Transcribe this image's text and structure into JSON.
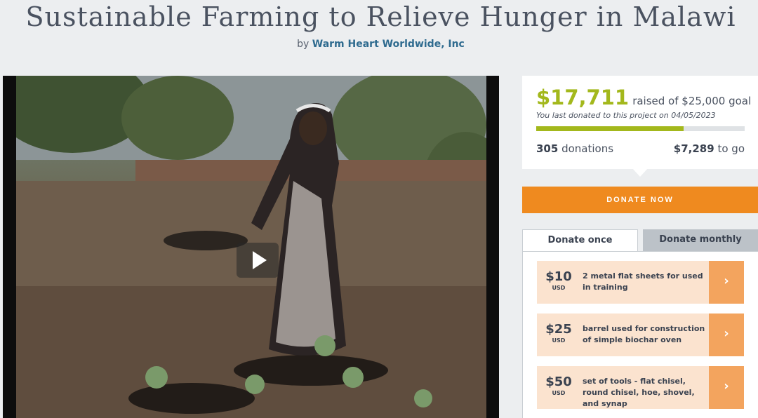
{
  "header": {
    "title": "Sustainable Farming to Relieve Hunger in Malawi",
    "by_prefix": "by",
    "organization": "Warm Heart Worldwide, Inc"
  },
  "video": {
    "play_icon": "play-icon"
  },
  "stats": {
    "raised_amount": "$17,711",
    "raised_goal": "raised of $25,000 goal",
    "last_donated": "You last donated to this project on 04/05/2023",
    "progress_fraction": 0.708,
    "donations_count": "305",
    "donations_label": "donations",
    "to_go_amount": "$7,289",
    "to_go_label": "to go"
  },
  "donate_now_label": "DONATE NOW",
  "tabs": {
    "once": "Donate once",
    "monthly": "Donate monthly"
  },
  "options": [
    {
      "amount": "$10",
      "currency": "USD",
      "description": "2 metal flat sheets for used in training"
    },
    {
      "amount": "$25",
      "currency": "USD",
      "description": "barrel used for construction of simple biochar oven"
    },
    {
      "amount": "$50",
      "currency": "USD",
      "description": "set of tools - flat chisel, round chisel, hoe, shovel, and synap"
    }
  ],
  "colors": {
    "accent_green": "#a3b81c",
    "donate_orange": "#ef8a1f",
    "option_bg": "#fbe3cf",
    "option_arrow_bg": "#f3a45e"
  }
}
